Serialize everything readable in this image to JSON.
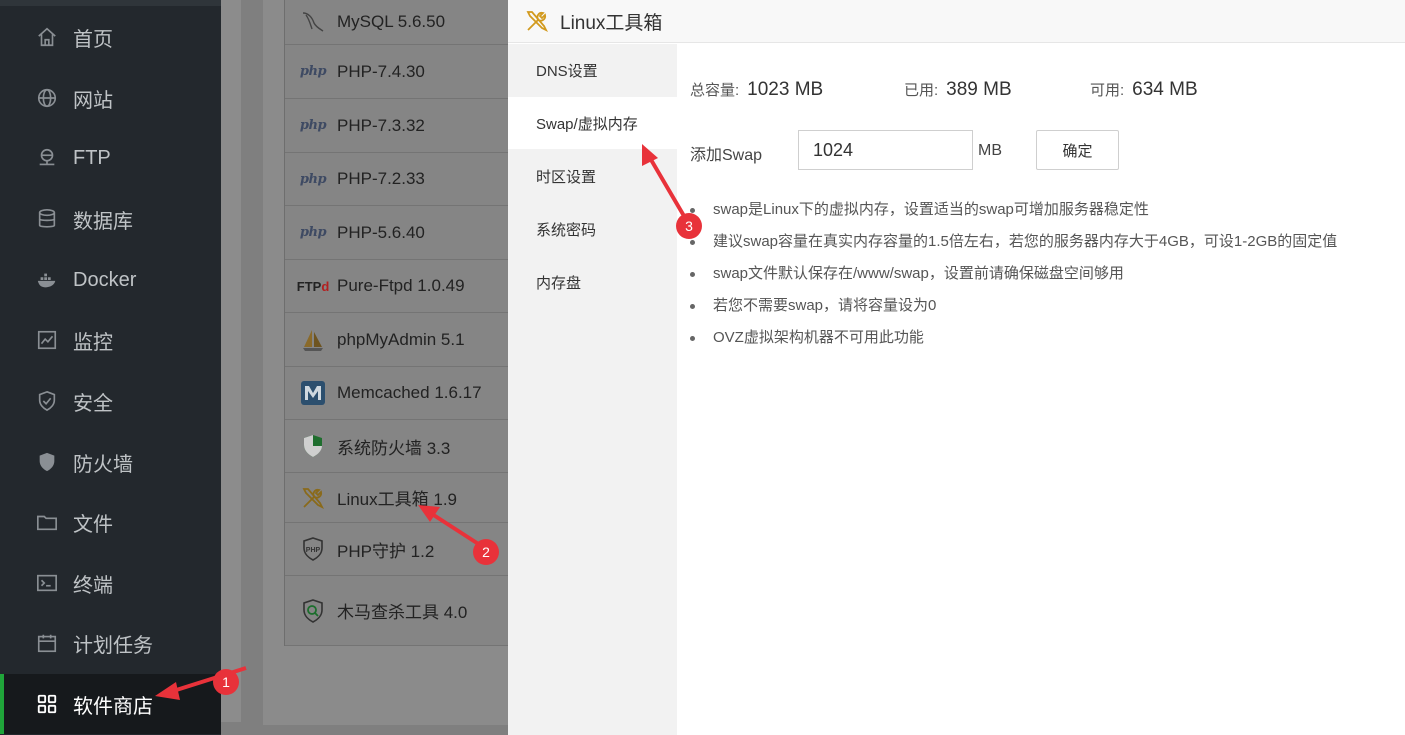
{
  "sidebar": {
    "items": [
      {
        "label": "首页",
        "icon": "home-icon"
      },
      {
        "label": "网站",
        "icon": "globe-icon"
      },
      {
        "label": "FTP",
        "icon": "ftp-icon"
      },
      {
        "label": "数据库",
        "icon": "database-icon"
      },
      {
        "label": "Docker",
        "icon": "docker-icon"
      },
      {
        "label": "监控",
        "icon": "monitor-icon"
      },
      {
        "label": "安全",
        "icon": "shield-check-icon"
      },
      {
        "label": "防火墙",
        "icon": "firewall-shield-icon"
      },
      {
        "label": "文件",
        "icon": "folder-icon"
      },
      {
        "label": "终端",
        "icon": "terminal-icon"
      },
      {
        "label": "计划任务",
        "icon": "calendar-icon"
      },
      {
        "label": "软件商店",
        "icon": "grid-apps-icon"
      }
    ],
    "active_index": 11,
    "accent_color": "#20a53a"
  },
  "plugins": [
    {
      "label": "MySQL 5.6.50",
      "icon": "mysql-dolphin-icon"
    },
    {
      "label": "PHP-7.4.30",
      "icon": "php-icon"
    },
    {
      "label": "PHP-7.3.32",
      "icon": "php-icon"
    },
    {
      "label": "PHP-7.2.33",
      "icon": "php-icon"
    },
    {
      "label": "PHP-5.6.40",
      "icon": "php-icon"
    },
    {
      "label": "Pure-Ftpd 1.0.49",
      "icon": "ftp-logo-icon"
    },
    {
      "label": "phpMyAdmin 5.1",
      "icon": "sailboat-icon"
    },
    {
      "label": "Memcached 1.6.17",
      "icon": "memcached-m-icon"
    },
    {
      "label": "系统防火墙 3.3",
      "icon": "green-shield-icon"
    },
    {
      "label": "Linux工具箱 1.9",
      "icon": "tools-icon"
    },
    {
      "label": "PHP守护 1.2",
      "icon": "php-shield-icon"
    },
    {
      "label": "木马查杀工具 4.0",
      "icon": "scan-shield-icon"
    }
  ],
  "php_logo_text": "php",
  "ftp_logo_text": "FTP",
  "dialog": {
    "title": "Linux工具箱",
    "tabs": [
      "DNS设置",
      "Swap/虚拟内存",
      "时区设置",
      "系统密码",
      "内存盘"
    ],
    "active_tab": 1,
    "stats": {
      "total_label": "总容量:",
      "total_value": "1023 MB",
      "used_label": "已用:",
      "used_value": "389 MB",
      "free_label": "可用:",
      "free_value": "634 MB"
    },
    "swap": {
      "label": "添加Swap",
      "value": "1024",
      "unit": "MB",
      "confirm_label": "确定"
    },
    "tips": [
      "swap是Linux下的虚拟内存，设置适当的swap可增加服务器稳定性",
      "建议swap容量在真实内存容量的1.5倍左右，若您的服务器内存大于4GB，可设1-2GB的固定值",
      "swap文件默认保存在/www/swap，设置前请确保磁盘空间够用",
      "若您不需要swap，请将容量设为0",
      "OVZ虚拟架构机器不可用此功能"
    ]
  },
  "annotations": {
    "color": "#e8323a",
    "badges": [
      "1",
      "2",
      "3"
    ]
  }
}
